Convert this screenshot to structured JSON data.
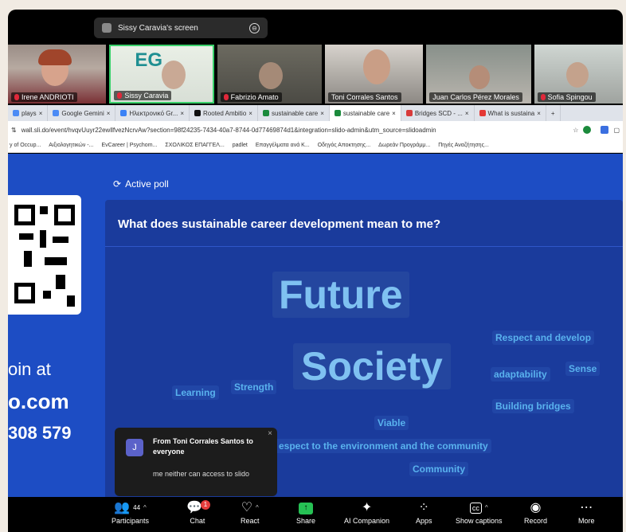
{
  "share_banner": {
    "title": "Sissy Caravia's screen",
    "icon": "share-screen-icon"
  },
  "participants": [
    {
      "name": "Irene ANDRIOTI",
      "muted": true
    },
    {
      "name": "Sissy Caravia",
      "muted": true,
      "speaking": true
    },
    {
      "name": "Fabrizio Amato",
      "muted": true
    },
    {
      "name": "Toni Corrales Santos",
      "muted": false
    },
    {
      "name": "Juan Carlos Pérez Morales",
      "muted": false
    },
    {
      "name": "Sofia Spingou",
      "muted": true
    }
  ],
  "browser": {
    "tabs": [
      {
        "label": "plays",
        "color": "#4c8bf5"
      },
      {
        "label": "Google Gemini",
        "color": "#4c8bf5"
      },
      {
        "label": "Ηλεκτρονικό Gr...",
        "color": "#3b82f6"
      },
      {
        "label": "Rooted Ambitio",
        "color": "#111111"
      },
      {
        "label": "sustainable care",
        "color": "#1b8a3c"
      },
      {
        "label": "sustainable care",
        "color": "#1b8a3c",
        "active": true
      },
      {
        "label": "Bridges SCD - ...",
        "color": "#d83b3b"
      },
      {
        "label": "What is sustaina",
        "color": "#e53935"
      }
    ],
    "url": "wall.sli.do/event/hvqvUuyr22ewllfvezNcrvAw?section=98f24235-7434-40a7-8744-0d77469874d1&integration=slido-admin&utm_source=slidoadmin",
    "bookmarks": [
      "y of Occup...",
      "Αιξιολογητικών -...",
      "EvCareer | Psychom...",
      "ΣΧΟΛΙΚΟΣ ΕΠΑΓΓΕΛ...",
      "padlet",
      "Επαγγέλματα ανά Κ...",
      "Οδηγός Αποκτησης...",
      "Δωρεάν Προγράμμ...",
      "Πηγές Αναζήτησης..."
    ]
  },
  "slido": {
    "active_poll_label": "Active poll",
    "join_text": "oin at",
    "join_domain": "o.com",
    "join_code": "308 579",
    "question": "What does sustainable career development mean to me?",
    "words": [
      {
        "text": "Future",
        "size": "big"
      },
      {
        "text": "Society",
        "size": "big"
      },
      {
        "text": "Respect and develop",
        "size": "small"
      },
      {
        "text": "adaptability",
        "size": "small"
      },
      {
        "text": "Sense",
        "size": "small"
      },
      {
        "text": "Learning",
        "size": "small"
      },
      {
        "text": "Strength",
        "size": "small"
      },
      {
        "text": "Building bridges",
        "size": "small"
      },
      {
        "text": "Viable",
        "size": "small"
      },
      {
        "text": "espect to the environment and the community",
        "size": "small"
      },
      {
        "text": "Community",
        "size": "small"
      }
    ]
  },
  "chat_toast": {
    "avatar_letter": "J",
    "from": "From Toni Corrales Santos to everyone",
    "message": "me neither can access to slido",
    "close": "×"
  },
  "toolbar": {
    "participants_label": "Participants",
    "participants_count": "44",
    "chat_label": "Chat",
    "chat_badge": "1",
    "react_label": "React",
    "share_label": "Share",
    "ai_label": "AI Companion",
    "apps_label": "Apps",
    "captions_label": "Show captions",
    "captions_glyph": "cc",
    "record_label": "Record",
    "more_label": "More"
  }
}
